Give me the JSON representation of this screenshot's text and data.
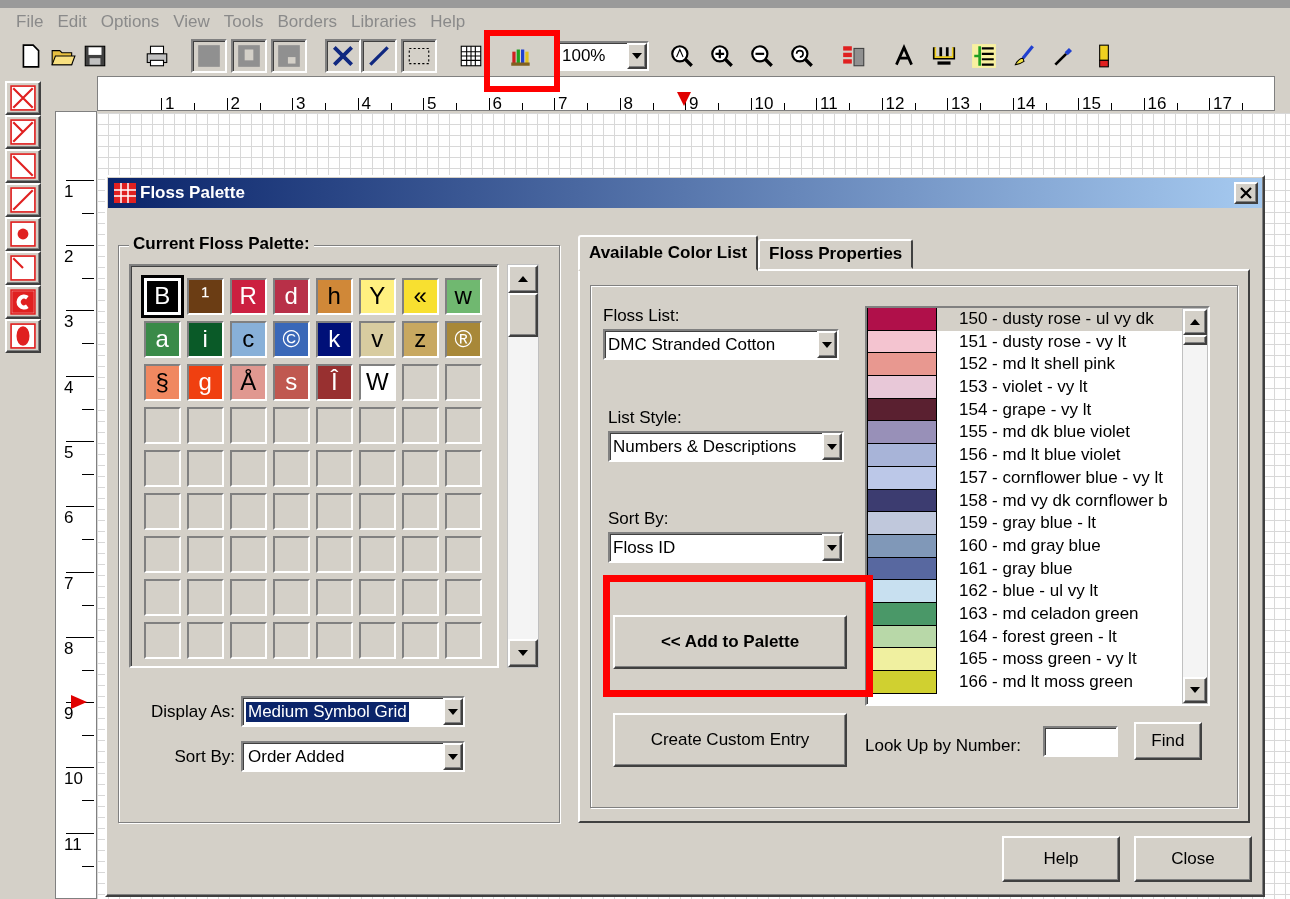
{
  "menu": [
    "File",
    "Edit",
    "Options",
    "View",
    "Tools",
    "Borders",
    "Libraries",
    "Help"
  ],
  "toolbar": {
    "zoom": "100%"
  },
  "rulers": {
    "horizontal": [
      "1",
      "2",
      "3",
      "4",
      "5",
      "6",
      "7",
      "8",
      "9",
      "10",
      "11",
      "12",
      "13",
      "14",
      "15",
      "16",
      "17"
    ],
    "vertical": [
      "1",
      "2",
      "3",
      "4",
      "5",
      "6",
      "7",
      "8",
      "9",
      "10",
      "11"
    ]
  },
  "dialog": {
    "title": "Floss Palette",
    "current_palette": {
      "title": "Current Floss Palette:",
      "swatches": [
        {
          "symbol": "B",
          "color": "#000000",
          "selected": true
        },
        {
          "symbol": "¹",
          "color": "#6b3d14",
          "selected": false
        },
        {
          "symbol": "R",
          "color": "#cc2040",
          "selected": false
        },
        {
          "symbol": "d",
          "color": "#b83048",
          "selected": false
        },
        {
          "symbol": "h",
          "color": "#d08838",
          "selected": false
        },
        {
          "symbol": "Y",
          "color": "#fff080",
          "selected": false
        },
        {
          "symbol": "«",
          "color": "#f8e030",
          "selected": false
        },
        {
          "symbol": "w",
          "color": "#70b870",
          "selected": false
        },
        {
          "symbol": "a",
          "color": "#3a8a48",
          "selected": false
        },
        {
          "symbol": "i",
          "color": "#0a5a28",
          "selected": false
        },
        {
          "symbol": "c",
          "color": "#88b0d8",
          "selected": false
        },
        {
          "symbol": "©",
          "color": "#3a68b8",
          "selected": false
        },
        {
          "symbol": "k",
          "color": "#001078",
          "selected": false
        },
        {
          "symbol": "v",
          "color": "#d8cca0",
          "selected": false
        },
        {
          "symbol": "z",
          "color": "#c8a860",
          "selected": false
        },
        {
          "symbol": "®",
          "color": "#a88838",
          "selected": false
        },
        {
          "symbol": "§",
          "color": "#f08860",
          "selected": false
        },
        {
          "symbol": "g",
          "color": "#f04010",
          "selected": false
        },
        {
          "symbol": "Å",
          "color": "#e09890",
          "selected": false
        },
        {
          "symbol": "s",
          "color": "#c05850",
          "selected": false
        },
        {
          "symbol": "Î",
          "color": "#983030",
          "selected": false
        },
        {
          "symbol": "W",
          "color": "#ffffff",
          "selected": false
        }
      ],
      "display_as": {
        "label": "Display As:",
        "value": "Medium Symbol Grid",
        "focused": true
      },
      "sort_by": {
        "label": "Sort By:",
        "value": "Order Added",
        "focused": false
      }
    },
    "tabs": [
      {
        "label": "Available Color List",
        "selected": true
      },
      {
        "label": "Floss Properties",
        "selected": false
      }
    ],
    "floss_list": {
      "label": "Floss List:",
      "value": "DMC Stranded Cotton"
    },
    "list_style": {
      "label": "List Style:",
      "value": "Numbers & Descriptions"
    },
    "sort_by": {
      "label": "Sort By:",
      "value": "Floss ID"
    },
    "add_button": "<< Add to Palette",
    "colors": [
      {
        "label": "150 - dusty rose - ul vy dk",
        "color": "#b0104a",
        "selected": true
      },
      {
        "label": "151 - dusty rose - vy lt",
        "color": "#f4c4d0",
        "selected": false
      },
      {
        "label": "152 - md lt shell pink",
        "color": "#e89890",
        "selected": false
      },
      {
        "label": "153 - violet - vy lt",
        "color": "#e8c8d8",
        "selected": false
      },
      {
        "label": "154 - grape - vy lt",
        "color": "#5a2030",
        "selected": false
      },
      {
        "label": "155 - md dk blue violet",
        "color": "#9890b8",
        "selected": false
      },
      {
        "label": "156 - md lt blue violet",
        "color": "#a8b4d8",
        "selected": false
      },
      {
        "label": "157 - cornflower blue - vy lt",
        "color": "#bcc8e8",
        "selected": false
      },
      {
        "label": "158 - md vy dk cornflower b",
        "color": "#3c3c70",
        "selected": false
      },
      {
        "label": "159 - gray blue - lt",
        "color": "#c0c8dc",
        "selected": false
      },
      {
        "label": "160 - md gray blue",
        "color": "#8098b8",
        "selected": false
      },
      {
        "label": "161 - gray blue",
        "color": "#5868a0",
        "selected": false
      },
      {
        "label": "162 - blue - ul vy lt",
        "color": "#c8e0f0",
        "selected": false
      },
      {
        "label": "163 - md celadon green",
        "color": "#4a9868",
        "selected": false
      },
      {
        "label": "164 - forest green - lt",
        "color": "#b8d8a8",
        "selected": false
      },
      {
        "label": "165 - moss green - vy lt",
        "color": "#f0f0a0",
        "selected": false
      },
      {
        "label": "166 - md lt moss green",
        "color": "#d0d030",
        "selected": false
      }
    ],
    "custom_button": "Create Custom Entry",
    "lookup": {
      "label": "Look Up by Number:",
      "button": "Find"
    },
    "buttons": [
      "Help",
      "Close"
    ]
  }
}
